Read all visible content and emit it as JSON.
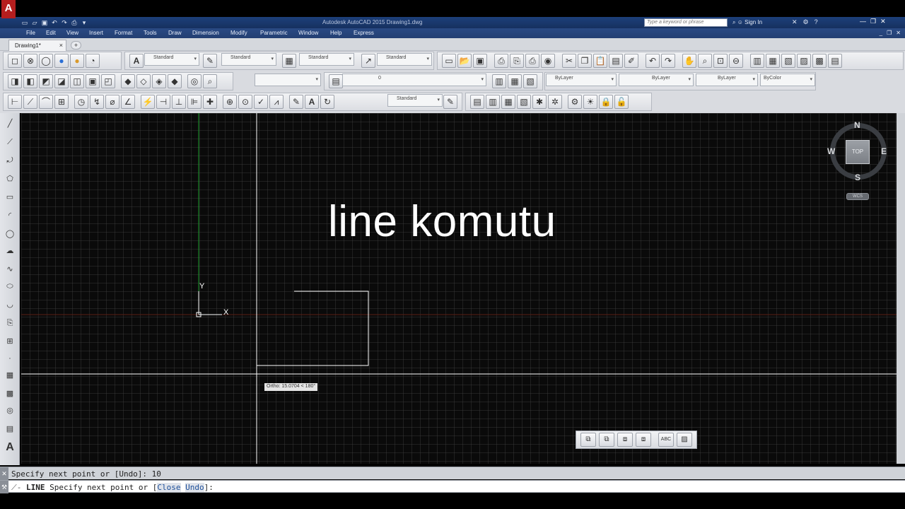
{
  "window": {
    "title": "Autodesk AutoCAD 2015    Drawing1.dwg",
    "app_logo": "A",
    "search_placeholder": "Type a keyword or phrase",
    "sign_in": "Sign In"
  },
  "menu": {
    "items": [
      "File",
      "Edit",
      "View",
      "Insert",
      "Format",
      "Tools",
      "Draw",
      "Dimension",
      "Modify",
      "Parametric",
      "Window",
      "Help",
      "Express"
    ]
  },
  "tabs": {
    "active": "Drawing1*",
    "close_glyph": "×",
    "new_glyph": "+"
  },
  "toolbars": {
    "text_style": "Standard",
    "dim_style": "Standard",
    "table_style": "Standard",
    "mleader_style": "Standard",
    "layer": "0",
    "color": "ByLayer",
    "linetype": "ByLayer",
    "lineweight": "ByLayer",
    "plotstyle": "ByColor",
    "annotative_style": "Standard"
  },
  "canvas": {
    "overlay_title": "line komutu",
    "ortho_tooltip": "Ortho: 15.0704 < 180°",
    "ucs_x": "X",
    "ucs_y": "Y"
  },
  "viewcube": {
    "north": "N",
    "south": "S",
    "east": "E",
    "west": "W",
    "face": "TOP",
    "wcs": "WCS"
  },
  "command": {
    "history": "Specify next point or [Undo]: 10",
    "command_name": "LINE",
    "prompt_prefix": "Specify next point or [",
    "option_close": "Close",
    "option_undo": "Undo",
    "prompt_suffix": "]:"
  },
  "colors": {
    "canvas_bg": "#0a0a0a",
    "title_bar": "#1d3f7a",
    "menu_bar": "#2a4a84",
    "crosshair": "#ffffff",
    "ucs_y_axis": "#1f9d2e",
    "app_logo_red": "#b51e1e"
  }
}
